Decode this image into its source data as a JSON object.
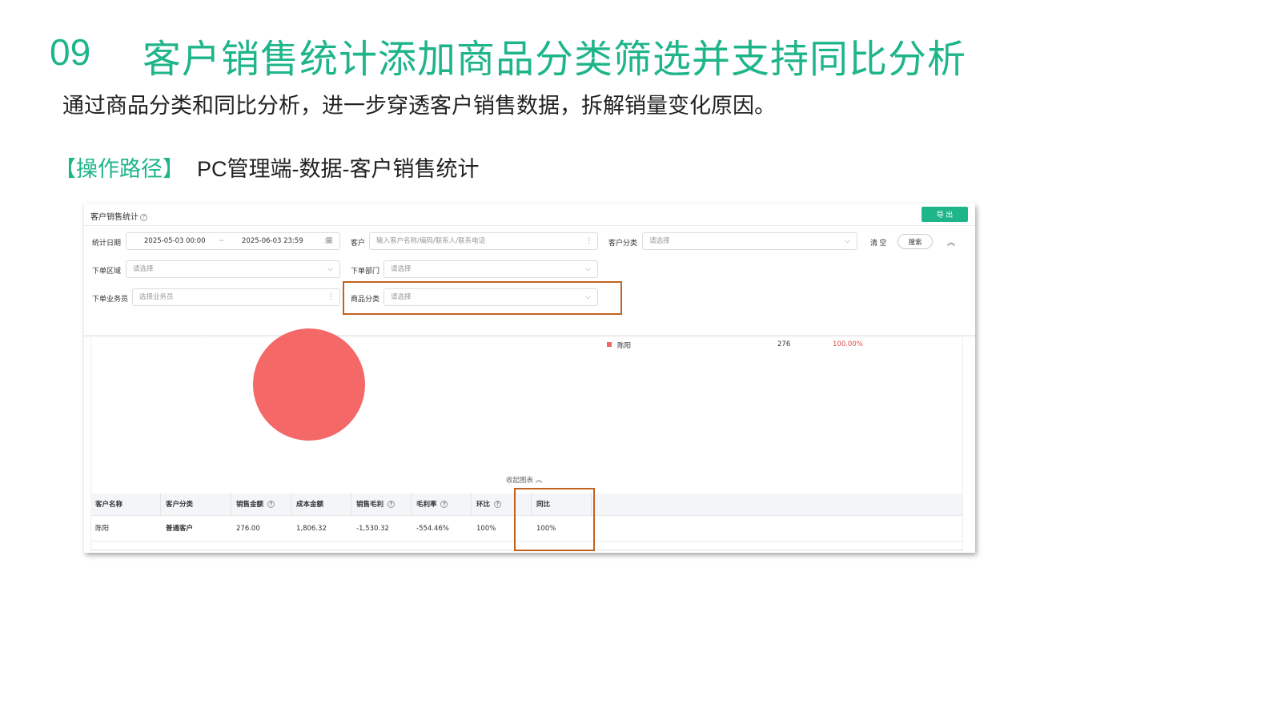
{
  "slide": {
    "number": "09",
    "title": "客户销售统计添加商品分类筛选并支持同比分析",
    "subtitle": "通过商品分类和同比分析，进一步穿透客户销售数据，拆解销量变化原因。",
    "path_label": "【操作路径】",
    "path_value": "PC管理端-数据-客户销售统计"
  },
  "panel": {
    "title": "客户销售统计",
    "help_icon": "?",
    "export_label": "导 出",
    "filters": {
      "date_label": "统计日期",
      "date_start": "2025-05-03 00:00",
      "date_sep": "~",
      "date_end": "2025-06-03 23:59",
      "calendar_icon": "🗓",
      "customer_label": "客户",
      "customer_placeholder": "输入客户名称/编码/联系人/联系电话",
      "customer_category_label": "客户分类",
      "customer_category_placeholder": "请选择",
      "clear_label": "清 空",
      "search_label": "搜索",
      "collapse_icon": "︽",
      "region_label": "下单区域",
      "region_placeholder": "请选择",
      "dept_label": "下单部门",
      "dept_placeholder": "请选择",
      "salesman_label": "下单业务员",
      "salesman_placeholder": "选择业务员",
      "goods_category_label": "商品分类",
      "goods_category_placeholder": "请选择",
      "chevron": "⌵",
      "more": "⋮"
    },
    "chart": {
      "legend_name": "陈阳",
      "legend_value": "276",
      "legend_percent": "100.00%",
      "color": "#f46868",
      "collapse_label": "收起图表 ︽"
    },
    "table": {
      "columns": [
        "客户名称",
        "客户分类",
        "销售金额",
        "成本金额",
        "销售毛利",
        "毛利率",
        "环比",
        "同比"
      ],
      "help_columns": [
        2,
        4,
        5,
        6
      ],
      "rows": [
        [
          "陈阳",
          "普通客户",
          "276.00",
          "1,806.32",
          "-1,530.32",
          "-554.46%",
          "100%",
          "100%"
        ]
      ]
    }
  },
  "colors": {
    "accent": "#1fb58a",
    "highlight": "#c0631f",
    "negative": "#e04848"
  }
}
